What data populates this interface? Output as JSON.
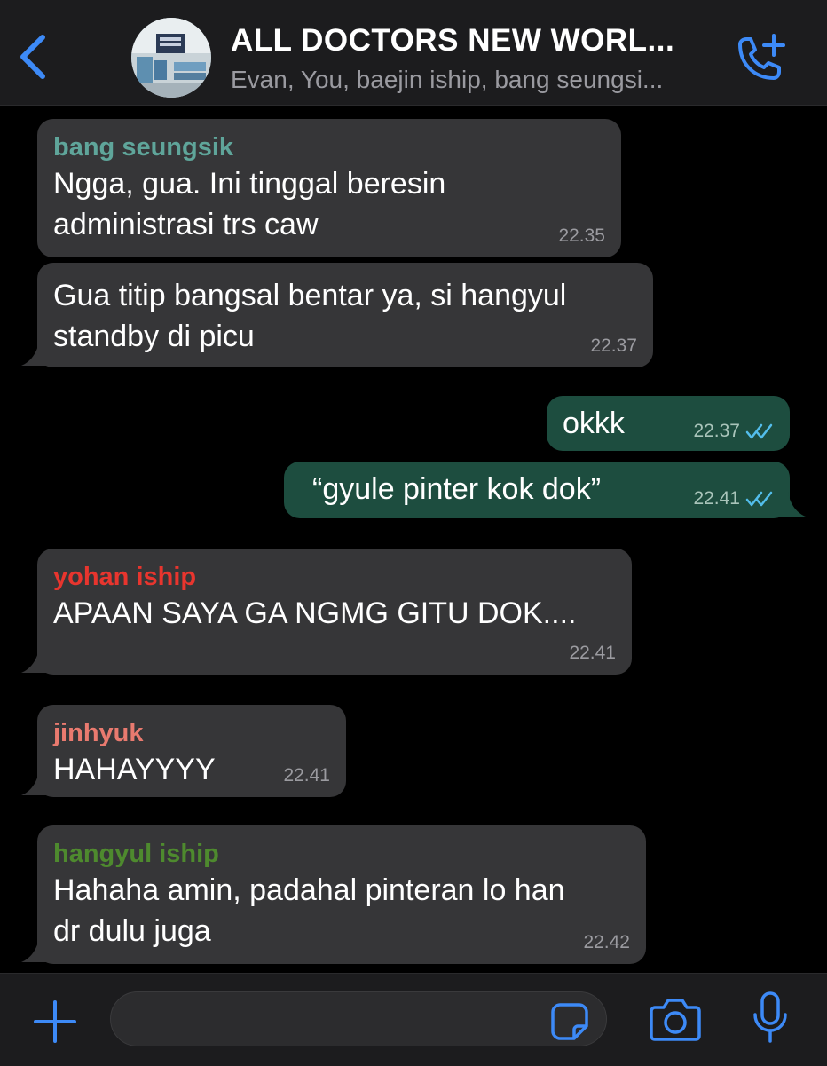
{
  "header": {
    "title": "ALL DOCTORS NEW WORL...",
    "subtitle": "Evan, You, baejin iship, bang seungsi...",
    "icons": [
      "chevron-left-icon",
      "group-avatar",
      "add-call-icon"
    ]
  },
  "messages": [
    {
      "sender": "bang seungsik",
      "sender_color": "#5fa59a",
      "text": "Ngga, gua. Ini tinggal beresin\nadministrasi trs caw",
      "time": "22.35",
      "direction": "in"
    },
    {
      "sender": "",
      "text": "Gua titip bangsal bentar ya, si hangyul\nstandby di picu",
      "time": "22.37",
      "direction": "in"
    },
    {
      "sender": "",
      "text": "okkk",
      "time": "22.37",
      "direction": "out",
      "status": "read"
    },
    {
      "sender": "",
      "text": "“gyule pinter kok dok”",
      "time": "22.41",
      "direction": "out",
      "status": "read"
    },
    {
      "sender": "yohan iship",
      "sender_color": "#e8352e",
      "text": "APAAN SAYA GA NGMG GITU DOK....",
      "time": "22.41",
      "direction": "in"
    },
    {
      "sender": "jinhyuk",
      "sender_color": "#e97a6f",
      "text": "HAHAYYYY",
      "time": "22.41",
      "direction": "in"
    },
    {
      "sender": "hangyul iship",
      "sender_color": "#4e8a2e",
      "text": "Hahaha amin, padahal pinteran lo han\ndr dulu juga",
      "time": "22.42",
      "direction": "in"
    }
  ],
  "composer": {
    "value": "",
    "icons": [
      "plus-icon",
      "sticker-icon",
      "camera-icon",
      "microphone-icon"
    ]
  },
  "colors": {
    "accent": "#3d8af7",
    "incoming_bubble": "#363638",
    "outgoing_bubble": "#1d4d3f",
    "read_ticks": "#53bdeb"
  }
}
